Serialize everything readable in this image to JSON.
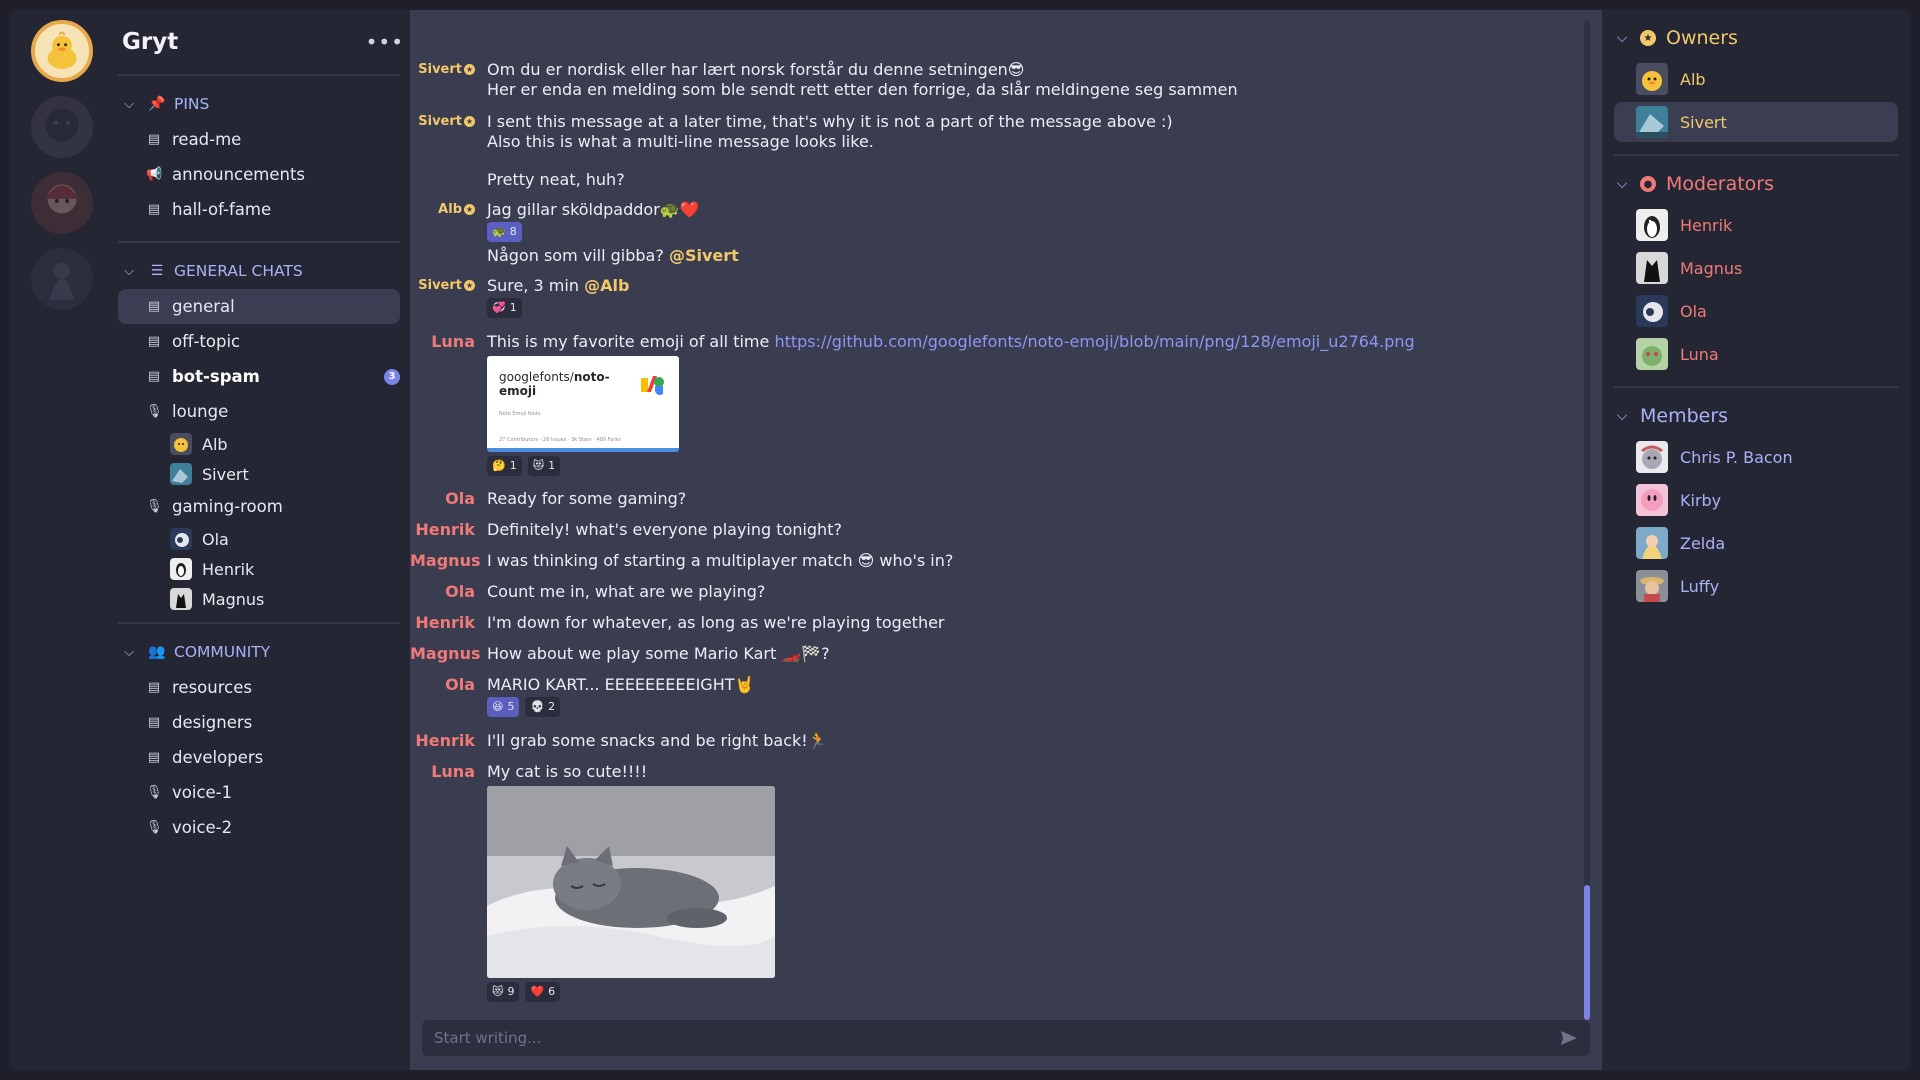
{
  "server": {
    "name": "Gryt"
  },
  "groups": {
    "pins": {
      "label": "PINS",
      "channels": [
        "read-me",
        "announcements",
        "hall-of-fame"
      ]
    },
    "general": {
      "label": "GENERAL CHATS",
      "channels": [
        "general",
        "off-topic",
        "bot-spam"
      ],
      "bot_spam_badge": "3",
      "lounge": {
        "name": "lounge",
        "users": [
          "Alb",
          "Sivert"
        ]
      },
      "gaming": {
        "name": "gaming-room",
        "users": [
          "Ola",
          "Henrik",
          "Magnus"
        ]
      }
    },
    "community": {
      "label": "COMMUNITY",
      "channels": [
        "resources",
        "designers",
        "developers",
        "voice-1",
        "voice-2"
      ]
    }
  },
  "messages": [
    {
      "author": "Sivert",
      "lines": [
        "Om du er nordisk eller har lært norsk forstår du denne setningen😎",
        "Her er enda en melding som ble sendt rett etter den forrige, da slår meldingene seg sammen"
      ]
    },
    {
      "author": "Sivert",
      "lines": [
        "I sent this message at a later time, that's why it is not a part of the message above :)",
        "Also this is what a multi-line message looks like.",
        "",
        "Pretty neat, huh?"
      ]
    },
    {
      "author": "Alb",
      "text": "Jag gillar sköldpaddor🐢❤️",
      "reaction": {
        "emoji": "🐢",
        "count": "8"
      },
      "text2": "Någon som vill gibba?",
      "mention": "@Sivert"
    },
    {
      "author": "Sivert",
      "text": "Sure, 3 min",
      "mention": "@Alb",
      "reaction": {
        "emoji": "💞",
        "count": "1"
      }
    },
    {
      "author": "Luna",
      "text": "This is my favorite emoji of all time",
      "link": "https://github.com/googlefonts/noto-emoji/blob/main/png/128/emoji_u2764.png",
      "embed": {
        "title_prefix": "googlefonts/",
        "title_bold": "noto-emoji",
        "subtitle": "Noto Emoji fonts",
        "stats": "27 Contributors · 28 Issues · 3k Stars · 400 Forks"
      },
      "reactions": [
        {
          "emoji": "🤔",
          "count": "1"
        },
        {
          "emoji": "😻",
          "count": "1"
        }
      ]
    },
    {
      "author": "Ola",
      "text": "Ready for some gaming?"
    },
    {
      "author": "Henrik",
      "text": "Definitely! what's everyone playing tonight?"
    },
    {
      "author": "Magnus",
      "text": "I was thinking of starting a multiplayer match 😎 who's in?"
    },
    {
      "author": "Ola",
      "text": "Count me in, what are we playing?"
    },
    {
      "author": "Henrik",
      "text": "I'm down for whatever, as long as we're playing together"
    },
    {
      "author": "Magnus",
      "text": "How about we play some Mario Kart 🏎️🏁?"
    },
    {
      "author": "Ola",
      "text": "MARIO KART... EEEEEEEEEIGHT🤘",
      "reactions": [
        {
          "emoji": "😆",
          "count": "5"
        },
        {
          "emoji": "💀",
          "count": "2"
        }
      ]
    },
    {
      "author": "Henrik",
      "text": "I'll grab some snacks and be right back!🏃"
    },
    {
      "author": "Luna",
      "text": "My cat is so cute!!!!",
      "reactions": [
        {
          "emoji": "😻",
          "count": "9"
        },
        {
          "emoji": "❤️",
          "count": "6"
        }
      ]
    }
  ],
  "composer": {
    "placeholder": "Start writing..."
  },
  "members_panel": {
    "owners": {
      "label": "Owners",
      "list": [
        "Alb",
        "Sivert"
      ]
    },
    "moderators": {
      "label": "Moderators",
      "list": [
        "Henrik",
        "Magnus",
        "Ola",
        "Luna"
      ]
    },
    "members": {
      "label": "Members",
      "list": [
        "Chris P. Bacon",
        "Kirby",
        "Zelda",
        "Luffy"
      ]
    }
  },
  "colors": {
    "accent": "#7b83e6",
    "owner": "#f2c86b",
    "moderator": "#f07a77",
    "member": "#a9b2f7"
  }
}
